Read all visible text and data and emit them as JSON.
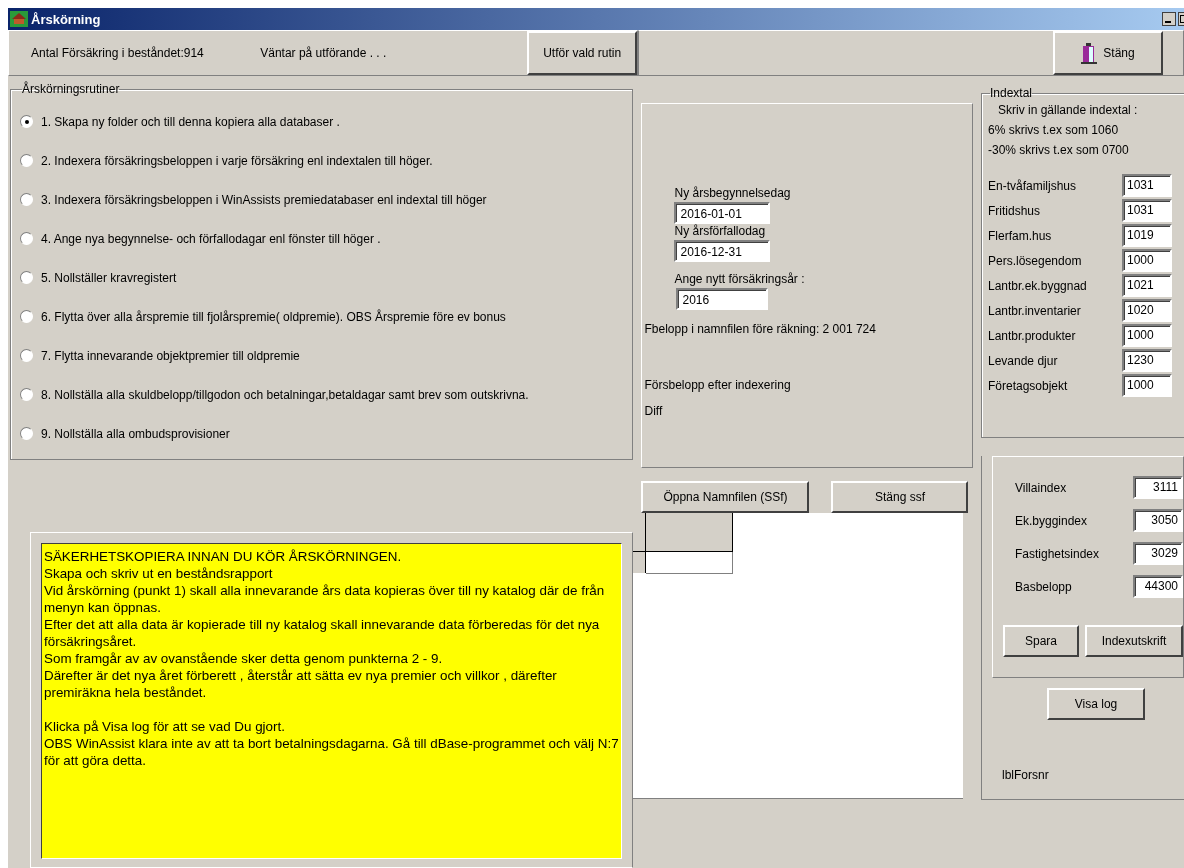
{
  "window": {
    "title": "Årskörning"
  },
  "toolbar": {
    "count_label": "Antal Försäkring i beståndet:914",
    "status": "Väntar på utförande . . .",
    "run_button": "Utför vald rutin",
    "close_button": "Stäng"
  },
  "routines": {
    "title": "Årskörningsrutiner",
    "options": [
      {
        "label": "1. Skapa ny folder och till denna kopiera alla databaser .",
        "selected": true
      },
      {
        "label": "2. Indexera försäkringsbeloppen i varje försäkring enl indextalen till höger.",
        "selected": false
      },
      {
        "label": "3. Indexera försäkringsbeloppen i WinAssists premiedatabaser enl indextal till höger",
        "selected": false
      },
      {
        "label": "4. Ange nya begynnelse- och förfallodagar enl fönster till höger .",
        "selected": false
      },
      {
        "label": "5. Nollställer kravregistert",
        "selected": false
      },
      {
        "label": "6. Flytta över alla årspremie till fjolårspremie( oldpremie). OBS Årspremie före ev bonus",
        "selected": false
      },
      {
        "label": "7. Flytta innevarande objektpremier till oldpremie",
        "selected": false
      },
      {
        "label": "8. Nollställa alla skuldbelopp/tillgodon och betalningar,betaldagar samt brev som outskrivna.",
        "selected": false
      },
      {
        "label": "9. Nollställa alla ombudsprovisioner",
        "selected": false
      }
    ]
  },
  "dates": {
    "fields": [
      {
        "label": "Ny årsbegynnelsedag",
        "value": "2016-01-01"
      },
      {
        "label": "Ny årsförfallodag",
        "value": "2016-12-31"
      },
      {
        "label": "Ange nytt försäkringsår :",
        "value": "2016"
      }
    ],
    "fbelopp": "Fbelopp i namnfilen före räkning: 2 001 724",
    "forsbelopp": "Försbelopp efter indexering",
    "diff": "Diff"
  },
  "file_buttons": [
    "Öppna Namnfilen (SSf)",
    "Stäng ssf"
  ],
  "notes": {
    "paragraphs": [
      [
        "SÄKERHETSKOPIERA INNAN DU KÖR ÅRSKÖRNINGEN.",
        "Skapa och skriv ut en beståndsrapport",
        "Vid årskörning (punkt 1) skall alla innevarande års data kopieras över till ny katalog där de från menyn kan öppnas.",
        "Efter det att alla data är kopierade till ny katalog skall innevarande data förberedas för det nya försäkringsåret.",
        "Som framgår av av ovanstående sker detta genom punkterna 2 - 9.",
        "Därefter är det nya året förberett , återstår att sätta ev nya premier och villkor , därefter premiräkna hela beståndet."
      ],
      [
        "Klicka på Visa log  för att se vad Du gjort.",
        "OBS WinAssist klara inte av att ta bort betalningsdagarna. Gå till dBase-programmet och välj N:7 för att göra detta."
      ]
    ]
  },
  "indextal": {
    "title": "Indextal",
    "instructions": [
      "Skriv in gällande indextal :",
      "6% skrivs t.ex som 1060",
      "-30% skrivs t.ex som 0700"
    ],
    "rows": [
      {
        "label": "En-tvåfamiljshus",
        "value": "1031"
      },
      {
        "label": "Fritidshus",
        "value": "1031"
      },
      {
        "label": "Flerfam.hus",
        "value": "1019"
      },
      {
        "label": "Pers.lösegendom",
        "value": "1000"
      },
      {
        "label": "Lantbr.ek.byggnad",
        "value": "1021"
      },
      {
        "label": "Lantbr.inventarier",
        "value": "1020"
      },
      {
        "label": "Lantbr.produkter",
        "value": "1000"
      },
      {
        "label": "Levande djur",
        "value": "1230"
      },
      {
        "label": "Företagsobjekt",
        "value": "1000"
      }
    ]
  },
  "indices": {
    "rows": [
      {
        "label": "Villaindex",
        "value": "3111"
      },
      {
        "label": "Ek.byggindex",
        "value": "3050"
      },
      {
        "label": "Fastighetsindex",
        "value": "3029"
      },
      {
        "label": "Basbelopp",
        "value": "44300"
      }
    ],
    "buttons": [
      "Spara",
      "Indexutskrift"
    ]
  },
  "visa_log": "Visa log",
  "lbl_forsnr": "lblForsnr"
}
